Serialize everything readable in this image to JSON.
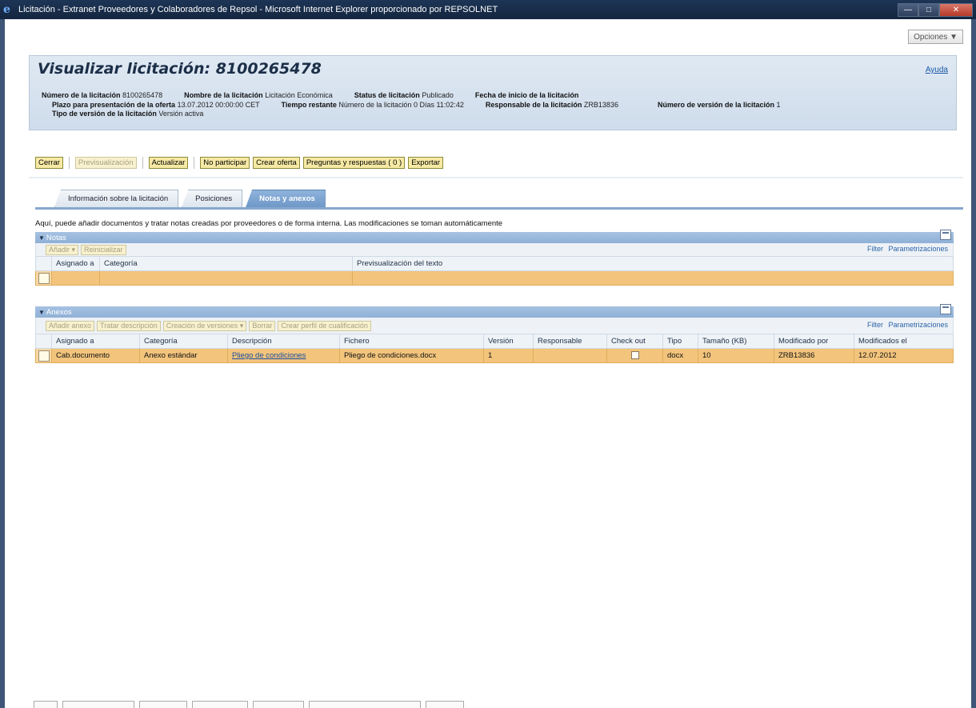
{
  "window": {
    "title": "Licitación - Extranet Proveedores y Colaboradores de Repsol - Microsoft Internet Explorer proporcionado por REPSOLNET"
  },
  "opciones_label": "Opciones ▼",
  "page": {
    "title": "Visualizar licitación: 8100265478",
    "help_link": "Ayuda"
  },
  "meta": {
    "numero_label": "Número de la licitación",
    "numero_value": "8100265478",
    "nombre_label": "Nombre de la licitación",
    "nombre_value": "Licitación Económica",
    "status_label": "Status de licitación",
    "status_value": "Publicado",
    "fecha_label": "Fecha de inicio de la licitación",
    "plazo_label": "Plazo para presentación de la oferta",
    "plazo_value": "13.07.2012 00:00:00 CET",
    "tiempo_label": "Tiempo restante",
    "tiempo_value": "Número de la licitación 0 Días 11:02:42",
    "responsable_label": "Responsable de la licitación",
    "responsable_value": "ZRB13836",
    "version_num_label": "Número de versión de la licitación",
    "version_num_value": "1",
    "tipo_label": "Tipo de versión de la licitación",
    "tipo_value": "Versión activa"
  },
  "toolbar": {
    "cerrar": "Cerrar",
    "previsualizacion": "Previsualización",
    "actualizar": "Actualizar",
    "no_participar": "No participar",
    "crear_oferta": "Crear oferta",
    "preguntas": "Preguntas y respuestas ( 0 )",
    "exportar": "Exportar"
  },
  "tabs": {
    "info": "Información sobre la licitación",
    "posiciones": "Posiciones",
    "notas": "Notas y anexos"
  },
  "hint": "Aquí, puede añadir documentos y tratar notas creadas por proveedores o de forma interna. Las modificaciones se toman automáticamente",
  "notas": {
    "title": "Notas",
    "add": "Añadir ▾",
    "reset": "Reinicializar",
    "filter": "Filter",
    "settings": "Parametrizaciones",
    "columns": [
      "Asignado a",
      "Categoría",
      "Previsualización del texto"
    ]
  },
  "anexos": {
    "title": "Anexos",
    "add": "Añadir anexo",
    "edit_desc": "Tratar descripción",
    "versions": "Creación de versiones ▾",
    "delete": "Borrar",
    "profile": "Crear perfil de cualificación",
    "filter": "Filter",
    "settings": "Parametrizaciones",
    "columns": [
      "Asignado a",
      "Categoría",
      "Descripción",
      "Fichero",
      "Versión",
      "Responsable",
      "Check out",
      "Tipo",
      "Tamaño (KB)",
      "Modificado por",
      "Modificados el"
    ],
    "row": {
      "asignado": "Cab.documento",
      "categoria": "Anexo estándar",
      "descripcion": "Pliego de condiciones",
      "fichero": "Pliego de condiciones.docx",
      "version": "1",
      "responsable": "",
      "tipo": "docx",
      "tamano": "10",
      "modificado_por": "ZRB13836",
      "modificado_el": "12.07.2012"
    }
  }
}
